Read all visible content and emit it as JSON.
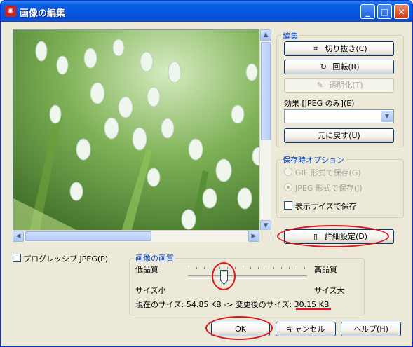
{
  "window": {
    "title": "画像の編集",
    "app_icon": "paint-app-icon",
    "controls": [
      "minimize-icon",
      "maximize-icon",
      "close-icon"
    ]
  },
  "edit": {
    "group_label": "編集",
    "crop": "切り抜き(C)",
    "rotate": "回転(R)",
    "transparent": "透明化(T)",
    "effect_label": "効果 [JPEG のみ](E)",
    "effect_value": "",
    "revert": "元に戻す(U)"
  },
  "save_options": {
    "group_label": "保存時オプション",
    "gif": "GIF 形式で保存(G)",
    "jpeg": "JPEG 形式で保存(J)",
    "display_size": "表示サイズで保存",
    "details": "詳細設定(D)"
  },
  "progressive": "プログレッシブ JPEG(P)",
  "quality": {
    "group_label": "画像の画質",
    "low": "低品質",
    "high": "高品質",
    "size_small": "サイズ小",
    "size_large": "サイズ大",
    "level_percent": 30,
    "size_prefix": "現在のサイズ: 54.85 KB -> 変更後のサイズ: ",
    "size_new": "30.15 KB"
  },
  "buttons": {
    "ok": "OK",
    "cancel": "キャンセル",
    "help": "ヘルプ(H)"
  },
  "colors": {
    "titlebar": "#0a5fe0",
    "group_label": "#0046d5",
    "annotation": "#e0141b",
    "preview_green": "#5f8a3e"
  }
}
